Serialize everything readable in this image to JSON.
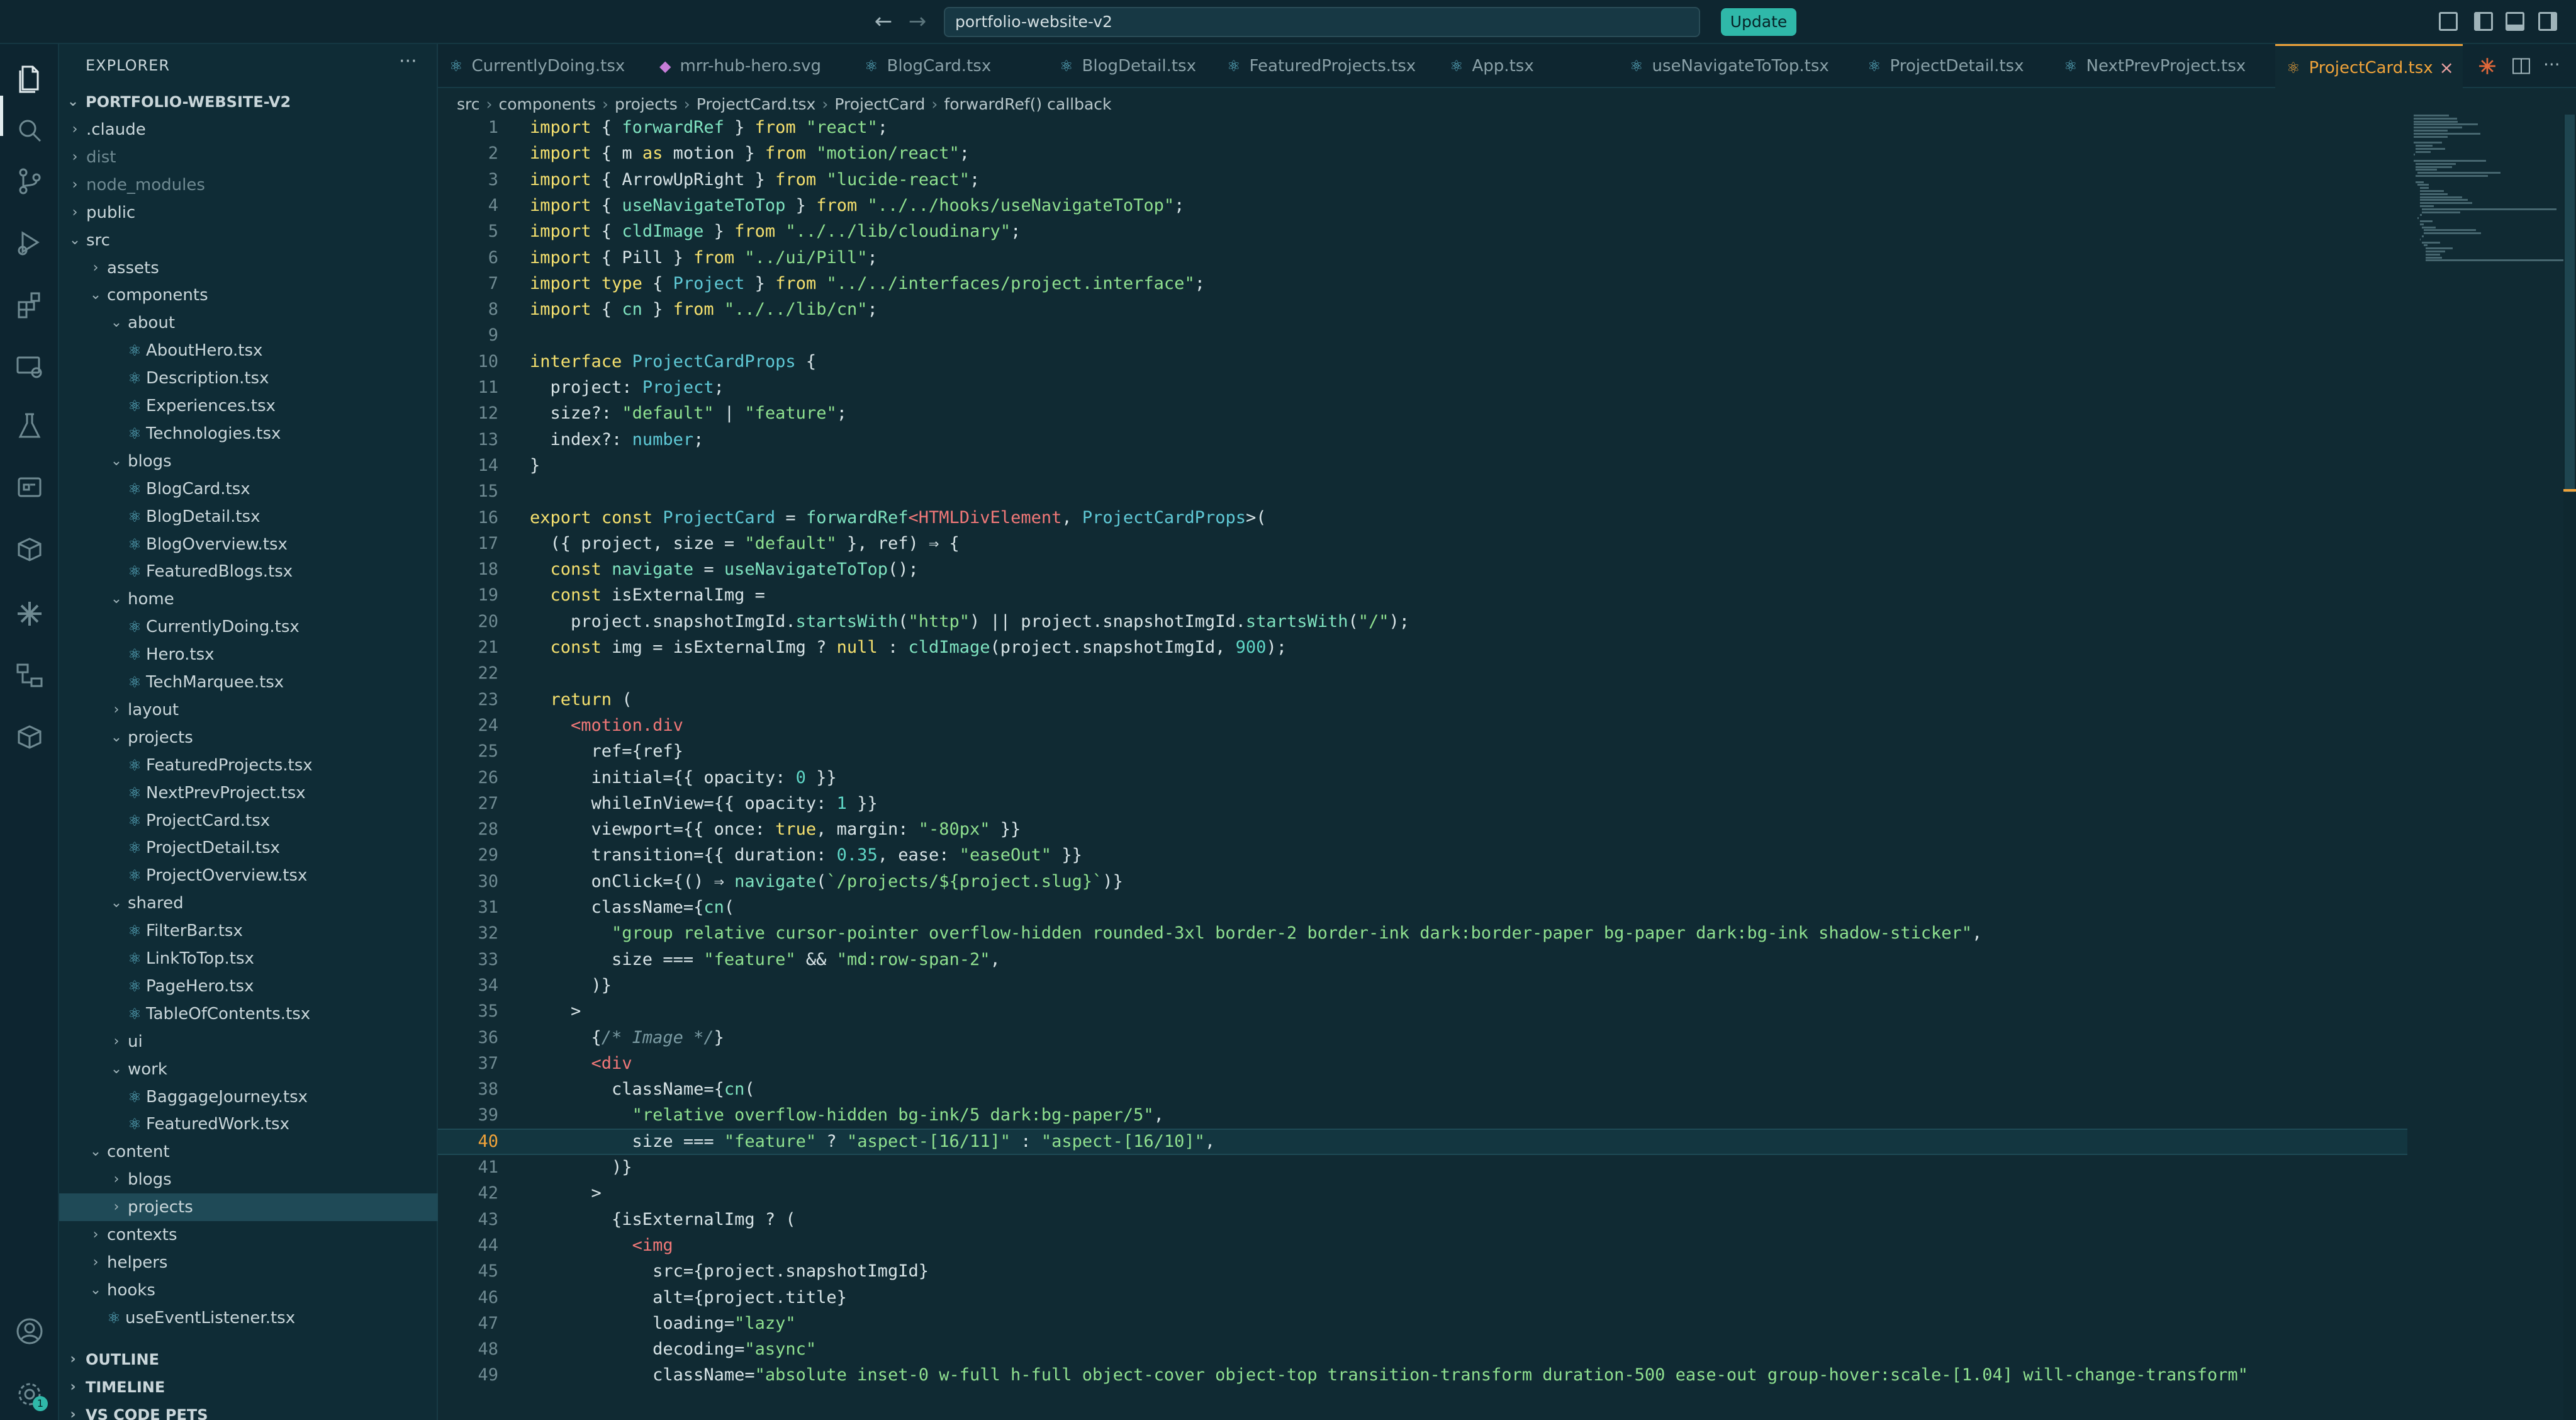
{
  "titlebar": {
    "search_value": "portfolio-website-v2",
    "update_label": "Update",
    "back_glyph": "←",
    "forward_glyph": "→"
  },
  "activity": {
    "icons": [
      "files-icon",
      "search-icon",
      "source-control-icon",
      "run-debug-icon",
      "extensions-icon",
      "remote-explorer-icon",
      "testing-icon",
      "docker-icon",
      "database-icon",
      "claude-icon",
      "remote-icon",
      "containers-icon"
    ],
    "bottom": [
      "account-icon",
      "settings-icon"
    ],
    "settings_badge": "1"
  },
  "explorer": {
    "title": "EXPLORER",
    "more": "···",
    "root": "PORTFOLIO-WEBSITE-V2",
    "items": [
      {
        "label": ".claude",
        "type": "folder",
        "depth": 1,
        "open": false,
        "dim": false
      },
      {
        "label": "dist",
        "type": "folder",
        "depth": 1,
        "open": false,
        "dim": true
      },
      {
        "label": "node_modules",
        "type": "folder",
        "depth": 1,
        "open": false,
        "dim": true
      },
      {
        "label": "public",
        "type": "folder",
        "depth": 1,
        "open": false,
        "dim": false
      },
      {
        "label": "src",
        "type": "folder",
        "depth": 1,
        "open": true,
        "dim": false
      },
      {
        "label": "assets",
        "type": "folder",
        "depth": 2,
        "open": false,
        "dim": false
      },
      {
        "label": "components",
        "type": "folder",
        "depth": 2,
        "open": true,
        "dim": false
      },
      {
        "label": "about",
        "type": "folder",
        "depth": 3,
        "open": true,
        "dim": false
      },
      {
        "label": "AboutHero.tsx",
        "type": "file",
        "depth": 4,
        "dim": false
      },
      {
        "label": "Description.tsx",
        "type": "file",
        "depth": 4,
        "dim": false
      },
      {
        "label": "Experiences.tsx",
        "type": "file",
        "depth": 4,
        "dim": false
      },
      {
        "label": "Technologies.tsx",
        "type": "file",
        "depth": 4,
        "dim": false
      },
      {
        "label": "blogs",
        "type": "folder",
        "depth": 3,
        "open": true,
        "dim": false
      },
      {
        "label": "BlogCard.tsx",
        "type": "file",
        "depth": 4,
        "dim": false
      },
      {
        "label": "BlogDetail.tsx",
        "type": "file",
        "depth": 4,
        "dim": false
      },
      {
        "label": "BlogOverview.tsx",
        "type": "file",
        "depth": 4,
        "dim": false
      },
      {
        "label": "FeaturedBlogs.tsx",
        "type": "file",
        "depth": 4,
        "dim": false
      },
      {
        "label": "home",
        "type": "folder",
        "depth": 3,
        "open": true,
        "dim": false
      },
      {
        "label": "CurrentlyDoing.tsx",
        "type": "file",
        "depth": 4,
        "dim": false
      },
      {
        "label": "Hero.tsx",
        "type": "file",
        "depth": 4,
        "dim": false
      },
      {
        "label": "TechMarquee.tsx",
        "type": "file",
        "depth": 4,
        "dim": false
      },
      {
        "label": "layout",
        "type": "folder",
        "depth": 3,
        "open": false,
        "dim": false
      },
      {
        "label": "projects",
        "type": "folder",
        "depth": 3,
        "open": true,
        "dim": false
      },
      {
        "label": "FeaturedProjects.tsx",
        "type": "file",
        "depth": 4,
        "dim": false
      },
      {
        "label": "NextPrevProject.tsx",
        "type": "file",
        "depth": 4,
        "dim": false
      },
      {
        "label": "ProjectCard.tsx",
        "type": "file",
        "depth": 4,
        "dim": false
      },
      {
        "label": "ProjectDetail.tsx",
        "type": "file",
        "depth": 4,
        "dim": false
      },
      {
        "label": "ProjectOverview.tsx",
        "type": "file",
        "depth": 4,
        "dim": false
      },
      {
        "label": "shared",
        "type": "folder",
        "depth": 3,
        "open": true,
        "dim": false
      },
      {
        "label": "FilterBar.tsx",
        "type": "file",
        "depth": 4,
        "dim": false
      },
      {
        "label": "LinkToTop.tsx",
        "type": "file",
        "depth": 4,
        "dim": false
      },
      {
        "label": "PageHero.tsx",
        "type": "file",
        "depth": 4,
        "dim": false
      },
      {
        "label": "TableOfContents.tsx",
        "type": "file",
        "depth": 4,
        "dim": false
      },
      {
        "label": "ui",
        "type": "folder",
        "depth": 3,
        "open": false,
        "dim": false
      },
      {
        "label": "work",
        "type": "folder",
        "depth": 3,
        "open": true,
        "dim": false
      },
      {
        "label": "BaggageJourney.tsx",
        "type": "file",
        "depth": 4,
        "dim": false
      },
      {
        "label": "FeaturedWork.tsx",
        "type": "file",
        "depth": 4,
        "dim": false
      },
      {
        "label": "content",
        "type": "folder",
        "depth": 2,
        "open": true,
        "dim": false
      },
      {
        "label": "blogs",
        "type": "folder",
        "depth": 3,
        "open": false,
        "dim": false
      },
      {
        "label": "projects",
        "type": "folder",
        "depth": 3,
        "open": false,
        "dim": false,
        "selected": true
      },
      {
        "label": "contexts",
        "type": "folder",
        "depth": 2,
        "open": false,
        "dim": false
      },
      {
        "label": "helpers",
        "type": "folder",
        "depth": 2,
        "open": false,
        "dim": false
      },
      {
        "label": "hooks",
        "type": "folder",
        "depth": 2,
        "open": true,
        "dim": false
      },
      {
        "label": "useEventListener.tsx",
        "type": "file",
        "depth": 3,
        "dim": false
      }
    ],
    "sections": [
      "OUTLINE",
      "TIMELINE",
      "VS CODE PETS"
    ]
  },
  "tabs": [
    {
      "label": "CurrentlyDoing.tsx",
      "icon": "react-icon",
      "active": false
    },
    {
      "label": "mrr-hub-hero.svg",
      "icon": "svg-icon",
      "active": false
    },
    {
      "label": "BlogCard.tsx",
      "icon": "react-icon",
      "active": false
    },
    {
      "label": "BlogDetail.tsx",
      "icon": "react-icon",
      "active": false
    },
    {
      "label": "FeaturedProjects.tsx",
      "icon": "react-icon",
      "active": false
    },
    {
      "label": "App.tsx",
      "icon": "react-icon",
      "active": false
    },
    {
      "label": "useNavigateToTop.tsx",
      "icon": "react-icon",
      "active": false
    },
    {
      "label": "ProjectDetail.tsx",
      "icon": "react-icon",
      "active": false
    },
    {
      "label": "NextPrevProject.tsx",
      "icon": "react-icon",
      "active": false
    },
    {
      "label": "ProjectCard.tsx",
      "icon": "react-icon",
      "active": true
    }
  ],
  "breadcrumb": [
    "src",
    "components",
    "projects",
    "ProjectCard.tsx",
    "ProjectCard",
    "forwardRef() callback"
  ],
  "editor": {
    "current_line": 40,
    "lines": [
      "import { forwardRef } from \"react\";",
      "import { m as motion } from \"motion/react\";",
      "import { ArrowUpRight } from \"lucide-react\";",
      "import { useNavigateToTop } from \"../../hooks/useNavigateToTop\";",
      "import { cldImage } from \"../../lib/cloudinary\";",
      "import { Pill } from \"../ui/Pill\";",
      "import type { Project } from \"../../interfaces/project.interface\";",
      "import { cn } from \"../../lib/cn\";",
      "",
      "interface ProjectCardProps {",
      "  project: Project;",
      "  size?: \"default\" | \"feature\";",
      "  index?: number;",
      "}",
      "",
      "export const ProjectCard = forwardRef<HTMLDivElement, ProjectCardProps>(",
      "  ({ project, size = \"default\" }, ref) ⇒ {",
      "  const navigate = useNavigateToTop();",
      "  const isExternalImg =",
      "    project.snapshotImgId.startsWith(\"http\") || project.snapshotImgId.startsWith(\"/\");",
      "  const img = isExternalImg ? null : cldImage(project.snapshotImgId, 900);",
      "",
      "  return (",
      "    <motion.div",
      "      ref={ref}",
      "      initial={{ opacity: 0 }}",
      "      whileInView={{ opacity: 1 }}",
      "      viewport={{ once: true, margin: \"-80px\" }}",
      "      transition={{ duration: 0.35, ease: \"easeOut\" }}",
      "      onClick={() ⇒ navigate(`/projects/${project.slug}`)}",
      "      className={cn(",
      "        \"group relative cursor-pointer overflow-hidden rounded-3xl border-2 border-ink dark:border-paper bg-paper dark:bg-ink shadow-sticker\",",
      "        size === \"feature\" && \"md:row-span-2\",",
      "      )}",
      "    >",
      "      {/* Image */}",
      "      <div",
      "        className={cn(",
      "          \"relative overflow-hidden bg-ink/5 dark:bg-paper/5\",",
      "          size === \"feature\" ? \"aspect-[16/11]\" : \"aspect-[16/10]\",",
      "        )}",
      "      >",
      "        {isExternalImg ? (",
      "          <img",
      "            src={project.snapshotImgId}",
      "            alt={project.title}",
      "            loading=\"lazy\"",
      "            decoding=\"async\"",
      "            className=\"absolute inset-0 w-full h-full object-cover object-top transition-transform duration-500 ease-out group-hover:scale-[1.04] will-change-transform\""
    ]
  },
  "colors": {
    "accent": "#f0a33a",
    "update_bg": "#2fb8a9",
    "keyword": "#f5e06e",
    "string": "#8fe08f",
    "type": "#5fc9d6",
    "func": "#7fe3c0",
    "tag": "#f07878"
  }
}
